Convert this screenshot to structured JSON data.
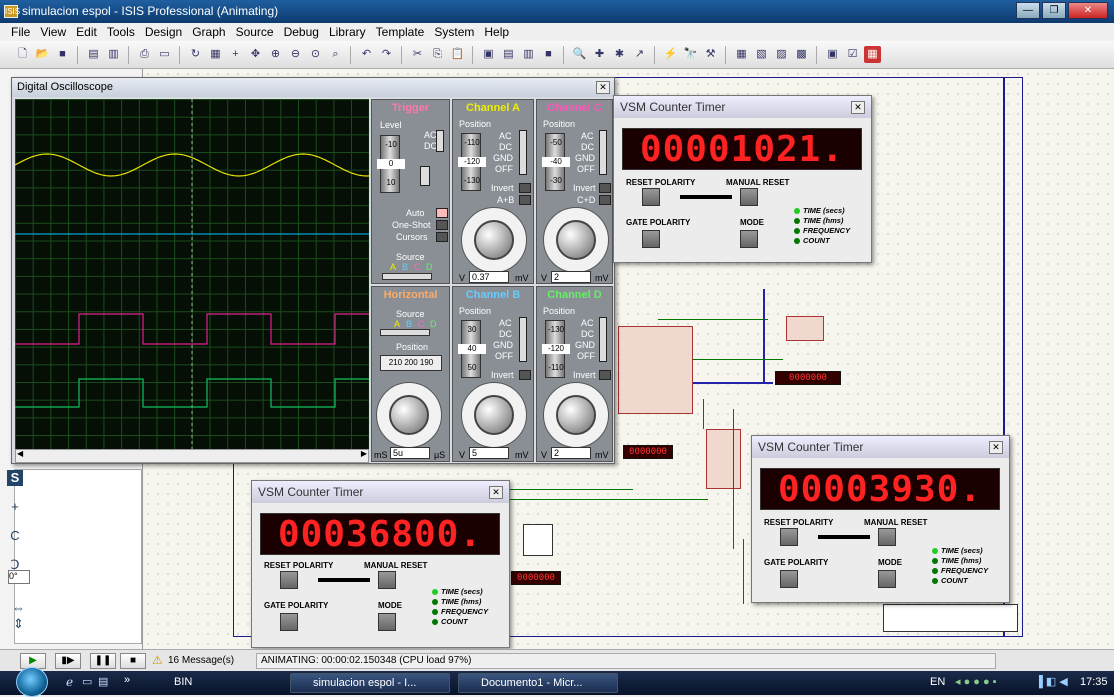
{
  "window": {
    "title": "simulacion espol - ISIS Professional (Animating)",
    "app_icon": "ISIS"
  },
  "menu": [
    "File",
    "View",
    "Edit",
    "Tools",
    "Design",
    "Graph",
    "Source",
    "Debug",
    "Library",
    "Template",
    "System",
    "Help"
  ],
  "oscilloscope": {
    "title": "Digital Oscilloscope",
    "trigger": {
      "title": "Trigger",
      "level_label": "Level",
      "ticks": [
        "-10",
        "0",
        "10"
      ],
      "coupling": [
        "AC",
        "DC"
      ],
      "modes": [
        "Auto",
        "One-Shot",
        "Cursors"
      ],
      "source_label": "Source",
      "sources": [
        "A",
        "B",
        "C",
        "D"
      ]
    },
    "channel_a": {
      "title": "Channel A",
      "position_label": "Position",
      "ticks": [
        "-110",
        "-120",
        "-130"
      ],
      "coupling": [
        "AC",
        "DC",
        "GND",
        "OFF"
      ],
      "invert": "Invert",
      "extra": "A+B",
      "scale_v": "V",
      "scale_mv": "mV",
      "value": "0.37"
    },
    "channel_c": {
      "title": "Channel C",
      "position_label": "Position",
      "ticks": [
        "-50",
        "-40",
        "-30"
      ],
      "coupling": [
        "AC",
        "DC",
        "GND",
        "OFF"
      ],
      "invert": "Invert",
      "extra": "C+D",
      "scale_v": "V",
      "scale_mv": "mV",
      "value": "2"
    },
    "horizontal": {
      "title": "Horizontal",
      "source_label": "Source",
      "sources": [
        "A",
        "B",
        "C",
        "D"
      ],
      "position_label": "Position",
      "position_readout": "210 200 190",
      "scale_ms": "mS",
      "scale_us": "µS",
      "value": "5u"
    },
    "channel_b": {
      "title": "Channel B",
      "position_label": "Position",
      "ticks": [
        "30",
        "40",
        "50"
      ],
      "coupling": [
        "AC",
        "DC",
        "GND",
        "OFF"
      ],
      "invert": "Invert",
      "scale_v": "V",
      "scale_mv": "mV",
      "value": "5"
    },
    "channel_d": {
      "title": "Channel D",
      "position_label": "Position",
      "ticks": [
        "-130",
        "-120",
        "-110"
      ],
      "coupling": [
        "AC",
        "DC",
        "GND",
        "OFF"
      ],
      "invert": "Invert",
      "scale_v": "V",
      "scale_mv": "mV",
      "value": "2"
    },
    "dial_ticks": [
      "0.5",
      "0.2",
      "0.1",
      "1",
      "2",
      "5",
      "10",
      "20",
      "50",
      "20",
      "10",
      "5",
      "2",
      "1"
    ],
    "colors": {
      "trace_a": "#e8e000",
      "trace_b": "#00a0d0",
      "trace_c": "#e0208c",
      "trace_d": "#10c060",
      "grid": "#1b4d1b"
    }
  },
  "counters": [
    {
      "title": "VSM Counter Timer",
      "digits": "00001021.",
      "reset_polarity": "RESET POLARITY",
      "manual_reset": "MANUAL RESET",
      "gate_polarity": "GATE POLARITY",
      "mode": "MODE",
      "modes": [
        "TIME (secs)",
        "TIME (hms)",
        "FREQUENCY",
        "COUNT"
      ]
    },
    {
      "title": "VSM Counter Timer",
      "digits": "00003930.",
      "reset_polarity": "RESET POLARITY",
      "manual_reset": "MANUAL RESET",
      "gate_polarity": "GATE POLARITY",
      "mode": "MODE",
      "modes": [
        "TIME (secs)",
        "TIME (hms)",
        "FREQUENCY",
        "COUNT"
      ]
    },
    {
      "title": "VSM Counter Timer",
      "digits": "00036800.",
      "reset_polarity": "RESET POLARITY",
      "manual_reset": "MANUAL RESET",
      "gate_polarity": "GATE POLARITY",
      "mode": "MODE",
      "modes": [
        "TIME (secs)",
        "TIME (hms)",
        "FREQUENCY",
        "COUNT"
      ]
    }
  ],
  "left_tools": [
    "S",
    "+",
    "C",
    "Ↄ"
  ],
  "angle_value": "0°",
  "status": {
    "messages": "16 Message(s)",
    "animating": "ANIMATING: 00:00:02.150348 (CPU load 97%)"
  },
  "taskbar": {
    "items": [
      "BIN",
      "simulacion espol - I...",
      "Documento1 - Micr..."
    ],
    "lang": "EN",
    "time": "17:35"
  }
}
